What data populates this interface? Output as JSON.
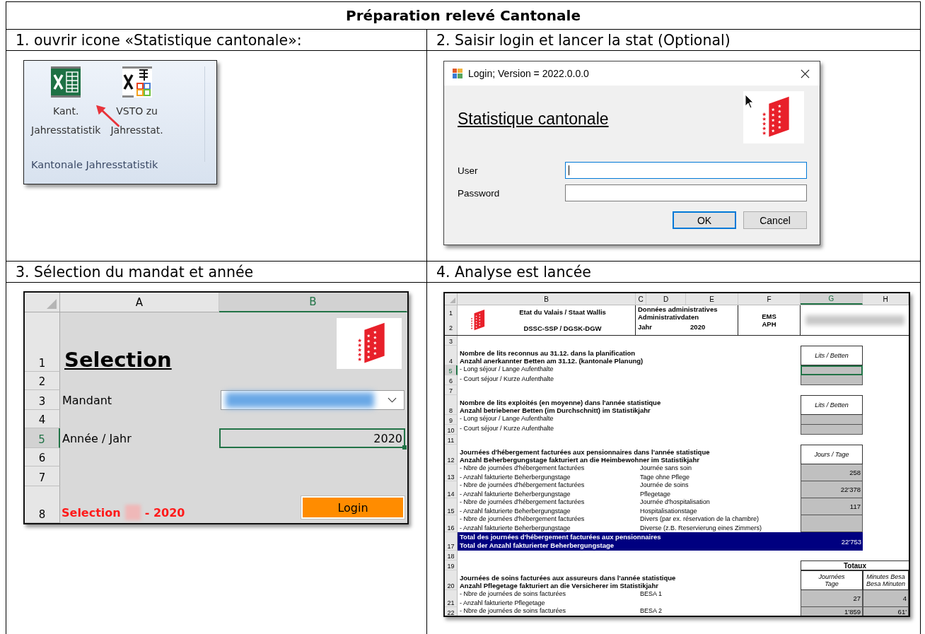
{
  "title": "Préparation relevé Cantonale",
  "step1": {
    "label": "1. ouvrir icone «Statistique cantonale»:",
    "ribbon": {
      "buttons": [
        {
          "kind": "excel",
          "lines": [
            "Kant.",
            "Jahresstatistik"
          ]
        },
        {
          "kind": "vsto",
          "lines": [
            "VSTO zu",
            "Jahresstat."
          ]
        }
      ],
      "group": "Kantonale Jahresstatistik"
    }
  },
  "step2": {
    "label": "2. Saisir login et lancer la stat (Optional)",
    "dialog": {
      "title": "Login; Version = 2022.0.0.0",
      "heading": "Statistique cantonale",
      "fields": [
        {
          "label": "User",
          "focused": true
        },
        {
          "label": "Password",
          "focused": false
        }
      ],
      "buttons": [
        {
          "label": "OK",
          "default": true
        },
        {
          "label": "Cancel",
          "default": false
        }
      ]
    }
  },
  "step3": {
    "label": "3. Sélection du mandat et année",
    "sheet": {
      "columns": [
        {
          "label": "A",
          "selected": false
        },
        {
          "label": "B",
          "selected": true
        }
      ],
      "rows": [
        {
          "number": "1",
          "selected": false
        },
        {
          "number": "2",
          "selected": false
        },
        {
          "number": "3",
          "selected": false
        },
        {
          "number": "4",
          "selected": false
        },
        {
          "number": "5",
          "selected": true
        },
        {
          "number": "6",
          "selected": false
        },
        {
          "number": "7",
          "selected": false
        },
        {
          "number": "8",
          "selected": false
        }
      ],
      "heading": "Selection",
      "mandant_label": "Mandant",
      "year_label": "Année / Jahr",
      "year_value": "2020",
      "status": [
        "Selection",
        "- 2020"
      ],
      "login": "Login"
    }
  },
  "step4": {
    "label": "4. Analyse est lancée",
    "sheet": {
      "columns": [
        {
          "label": "B",
          "selected": false
        },
        {
          "label": "C",
          "selected": false
        },
        {
          "label": "D",
          "selected": false
        },
        {
          "label": "E",
          "selected": false
        },
        {
          "label": "F",
          "selected": false
        },
        {
          "label": "G",
          "selected": true
        },
        {
          "label": "H",
          "selected": false
        }
      ],
      "header": {
        "org": [
          "Etat du Valais / Staat Wallis",
          "DSSC-SSP / DGSK-DGW"
        ],
        "admin": [
          "Données administratives",
          "Administrativdaten"
        ],
        "year_label": "Jahr",
        "year": "2020",
        "type": [
          "EMS",
          "APH"
        ]
      },
      "rows": [
        {
          "kind": "header",
          "numbers": [
            "1",
            "2"
          ],
          "selected": false
        },
        {
          "kind": "blank",
          "number": "3",
          "selected": false
        },
        {
          "kind": "section",
          "number": "4",
          "selected": false,
          "lines": [
            "Nombre de lits reconnus au 31.12. dans la planification",
            "Anzahl anerkannter Betten am 31.12. (kantonale Planung)"
          ],
          "heads": [
            {
              "lines": [
                "Lits / Betten"
              ]
            }
          ]
        },
        {
          "kind": "item",
          "number": "5",
          "selected": true,
          "lines": [
            "- Long séjour / Lange Aufenthalte"
          ]
        },
        {
          "kind": "item",
          "number": "6",
          "selected": false,
          "lines": [
            "- Court séjour / Kurze Aufenthalte"
          ]
        },
        {
          "kind": "blank",
          "number": "7",
          "selected": false
        },
        {
          "kind": "section",
          "number": "8",
          "selected": false,
          "lines": [
            "Nombre de lits exploités (en moyenne) dans l'année statistique",
            "Anzahl betriebener Betten (im Durchschnitt) im Statistikjahr"
          ],
          "heads": [
            {
              "lines": [
                "Lits / Betten"
              ]
            }
          ]
        },
        {
          "kind": "item",
          "number": "9",
          "selected": false,
          "lines": [
            "- Long séjour / Lange Aufenthalte"
          ]
        },
        {
          "kind": "item",
          "number": "10",
          "selected": false,
          "lines": [
            "- Court séjour / Kurze Aufenthalte"
          ]
        },
        {
          "kind": "blank",
          "number": "11",
          "selected": false
        },
        {
          "kind": "section",
          "number": "12",
          "selected": false,
          "lines": [
            "Journées d'hébergement facturées aux pensionnaires dans l'année statistique",
            "Anzahl Beherbergungstage fakturiert an die Heimbewohner im Statistikjahr"
          ],
          "heads": [
            {
              "lines": [
                "Jours / Tage"
              ]
            }
          ]
        },
        {
          "kind": "item",
          "number": "13",
          "selected": false,
          "lines": [
            "- Nbre de journées d'hébergement facturées",
            "- Anzahl fakturierte Beherbergungstage"
          ],
          "middle": [
            "Journée sans soin",
            "Tage ohne Pflege"
          ],
          "values": [
            "258"
          ]
        },
        {
          "kind": "item",
          "number": "14",
          "selected": false,
          "lines": [
            "- Nbre de journées d'hébergement facturées",
            "- Anzahl fakturierte Beherbergungstage"
          ],
          "middle": [
            "Journée de soins",
            "Pflegetage"
          ],
          "values": [
            "22'378"
          ]
        },
        {
          "kind": "item",
          "number": "15",
          "selected": false,
          "lines": [
            "- Nbre de journées d'hébergement facturées",
            "- Anzahl fakturierte Beherbergungstage"
          ],
          "middle": [
            "Journée d'hospitalisation",
            "Hospitalisationstage"
          ],
          "values": [
            "117"
          ]
        },
        {
          "kind": "item",
          "number": "16",
          "selected": false,
          "lines": [
            "- Nbre de journées d'hébergement facturées",
            "- Anzahl fakturierte Beherbergungstage"
          ],
          "middle": [
            "Divers (par ex. réservation de la chambre)",
            "Diverse (z.B. Reservierung eines Zimmers)"
          ]
        },
        {
          "kind": "total",
          "number": "17",
          "selected": false,
          "lines": [
            "Total des journées d'hébergement facturées aux pensionnaires",
            "Total der Anzahl fakturierter Beherbergungstage"
          ],
          "value": "22'753"
        },
        {
          "kind": "blank",
          "number": "18",
          "selected": false
        },
        {
          "kind": "group",
          "number": "19",
          "selected": false,
          "label": "Totaux"
        },
        {
          "kind": "section",
          "number": "20",
          "selected": false,
          "lines": [
            "Journées de soins facturées aux assureurs dans l'année statistique",
            "Anzahl Pflegetage fakturiert an die Versicherer im Statistikjahr"
          ],
          "heads": [
            {
              "lines": [
                "Journées",
                "Tage"
              ]
            },
            {
              "lines": [
                "Minutes Besa",
                "Besa Minuten"
              ]
            }
          ]
        },
        {
          "kind": "item",
          "number": "21",
          "selected": false,
          "lines": [
            "- Nbre de journées de soins facturées",
            "- Anzahl fakturierte Pflegetage"
          ],
          "middle": [
            "BESA 1"
          ],
          "values": [
            "27",
            "4"
          ]
        },
        {
          "kind": "item",
          "number": "22",
          "selected": false,
          "lines": [
            "- Nbre de journées de soins facturées"
          ],
          "middle": [
            "BESA 2"
          ],
          "values": [
            "1'859",
            "61'"
          ]
        }
      ]
    }
  }
}
